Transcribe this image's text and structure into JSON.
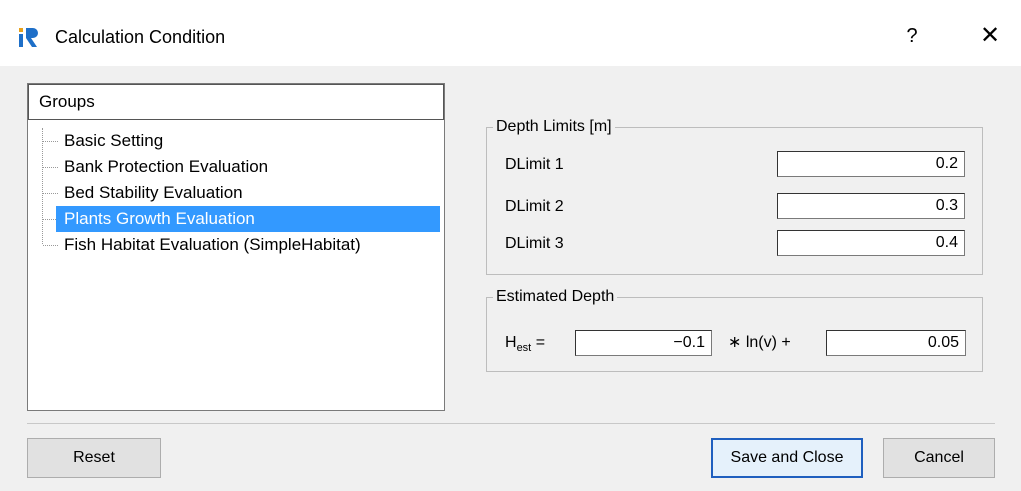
{
  "window": {
    "title": "Calculation Condition",
    "help_label": "?",
    "close_label": "✕",
    "app_icon": "iric-logo-icon"
  },
  "groups": {
    "header": "Groups",
    "items": [
      {
        "label": "Basic Setting",
        "selected": false
      },
      {
        "label": "Bank Protection Evaluation",
        "selected": false
      },
      {
        "label": "Bed Stability Evaluation",
        "selected": false
      },
      {
        "label": "Plants Growth Evaluation",
        "selected": true
      },
      {
        "label": "Fish Habitat Evaluation (SimpleHabitat)",
        "selected": false
      }
    ]
  },
  "depth_limits": {
    "legend": "Depth Limits [m]",
    "rows": [
      {
        "label": "DLimit 1",
        "value": "0.2"
      },
      {
        "label": "DLimit 2",
        "value": "0.3"
      },
      {
        "label": "DLimit 3",
        "value": "0.4"
      }
    ]
  },
  "estimated_depth": {
    "legend": "Estimated Depth",
    "lhs_main": "H",
    "lhs_sub": "est",
    "lhs_eq": " =",
    "coef": "−0.1",
    "middle_text": "∗ ln(v) +",
    "intercept": "0.05"
  },
  "buttons": {
    "reset": "Reset",
    "save_close": "Save and Close",
    "cancel": "Cancel"
  },
  "colors": {
    "selection": "#3399ff",
    "default_button_border": "#1f5fbf"
  }
}
